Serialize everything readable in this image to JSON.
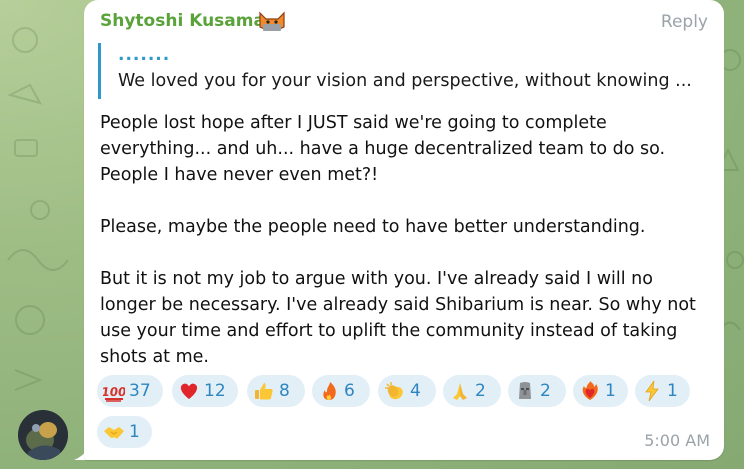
{
  "message": {
    "sender": "Shytoshi Kusama",
    "reply_label": "Reply",
    "quote": {
      "dots": ".......",
      "text": "We loved you for your vision and perspective, without knowing ..."
    },
    "body": [
      "People lost hope after I JUST said we're going to complete everything... and uh... have a huge decentralized team to do so. People I have never even met?!",
      "Please, maybe the people need to have better understanding.",
      "But it is not my job to argue with you. I've already said I will no longer be necessary.  I've already said Shibarium is near. So why not use your time and effort to uplift the community instead of taking shots at me."
    ],
    "time": "5:00 AM"
  },
  "reactions": [
    {
      "icon": "hundred-points-icon",
      "count": "37"
    },
    {
      "icon": "red-heart-icon",
      "count": "12"
    },
    {
      "icon": "thumbs-up-icon",
      "count": "8"
    },
    {
      "icon": "fire-icon",
      "count": "6"
    },
    {
      "icon": "clapping-hands-icon",
      "count": "4"
    },
    {
      "icon": "folded-hands-icon",
      "count": "2"
    },
    {
      "icon": "moai-icon",
      "count": "2"
    },
    {
      "icon": "heart-on-fire-icon",
      "count": "1"
    },
    {
      "icon": "lightning-icon",
      "count": "1"
    },
    {
      "icon": "handshake-icon",
      "count": "1"
    }
  ],
  "colors": {
    "sender": "#5aa33a",
    "accent": "#2f9ac9",
    "reaction_bg": "#e2eff7",
    "reaction_text": "#2e86c1",
    "meta_text": "#9aa3a8"
  }
}
